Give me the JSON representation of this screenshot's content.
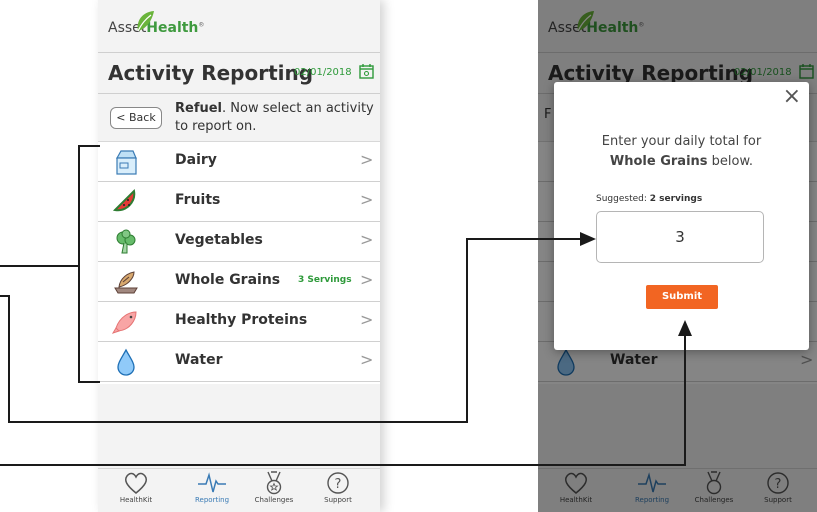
{
  "app": {
    "logo_left": "Asset",
    "logo_right": "Health",
    "logo_mark": "®"
  },
  "header": {
    "title": "Activity Reporting",
    "date": "02/01/2018"
  },
  "subheader": {
    "back_label": "Back",
    "prompt_bold": "Refuel",
    "prompt_rest": ". Now select an activity to report on."
  },
  "activities": [
    {
      "label": "Dairy",
      "icon": "milk-carton-icon",
      "badge": ""
    },
    {
      "label": "Fruits",
      "icon": "watermelon-icon",
      "badge": ""
    },
    {
      "label": "Vegetables",
      "icon": "broccoli-icon",
      "badge": ""
    },
    {
      "label": "Whole Grains",
      "icon": "bread-icon",
      "badge": "3 Servings"
    },
    {
      "label": "Healthy Proteins",
      "icon": "fish-icon",
      "badge": ""
    },
    {
      "label": "Water",
      "icon": "water-drop-icon",
      "badge": ""
    }
  ],
  "tabs": [
    {
      "label": "HealthKit",
      "icon": "heart-icon"
    },
    {
      "label": "Reporting",
      "icon": "pulse-icon",
      "active": true
    },
    {
      "label": "Challenges",
      "icon": "medal-icon"
    },
    {
      "label": "Support",
      "icon": "help-icon"
    }
  ],
  "modal": {
    "prompt_line1": "Enter your daily total for",
    "prompt_bold": "Whole Grains",
    "prompt_tail": " below.",
    "suggested_prefix": "Suggested: ",
    "suggested_value": "2 servings",
    "input_value": "3",
    "submit_label": "Submit",
    "close_symbol": "×"
  },
  "right_screen": {
    "first_row_partial": "F",
    "visible_row_label": "Water"
  },
  "colors": {
    "brand_green": "#2e9a3a",
    "accent_orange": "#f26522",
    "active_tab_blue": "#3a7bb5",
    "header_gray": "#f3f3f3"
  }
}
